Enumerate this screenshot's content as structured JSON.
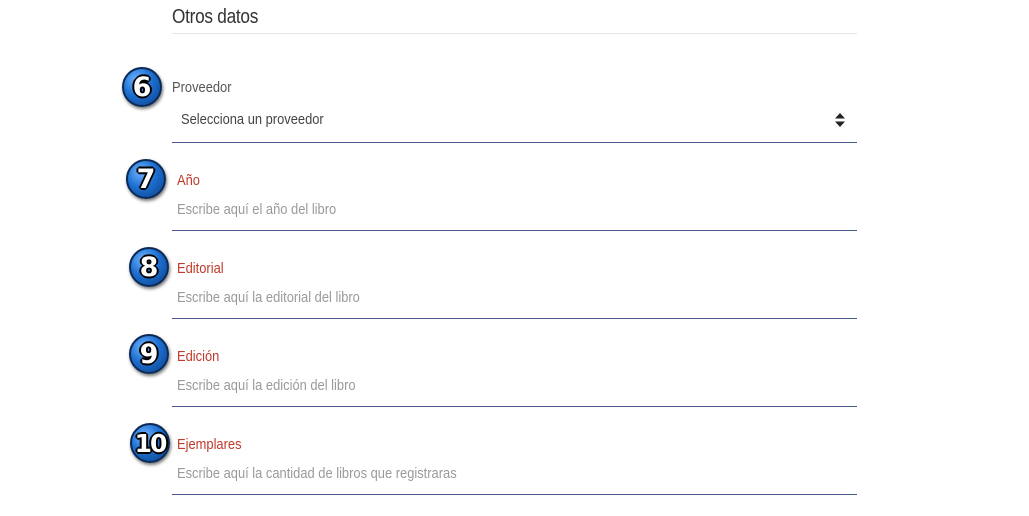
{
  "section": {
    "title": "Otros datos"
  },
  "markers": [
    "6",
    "7",
    "8",
    "9",
    "10"
  ],
  "fields": {
    "proveedor": {
      "label": "Proveedor",
      "selected": "Selecciona un proveedor"
    },
    "anio": {
      "label": "Año",
      "placeholder": "Escribe aquí el año del libro"
    },
    "editorial": {
      "label": "Editorial",
      "placeholder": "Escribe aquí la editorial del libro"
    },
    "edicion": {
      "label": "Edición",
      "placeholder": "Escribe aquí la edición del libro"
    },
    "ejemplares": {
      "label": "Ejemplares",
      "placeholder": "Escribe aquí la cantidad de libros que registraras"
    }
  },
  "colors": {
    "required_label": "#c0392b",
    "underline": "#4a5a8c",
    "marker": "#1d6fd1"
  },
  "icons": {
    "select_arrow": "sort-arrows-icon"
  }
}
